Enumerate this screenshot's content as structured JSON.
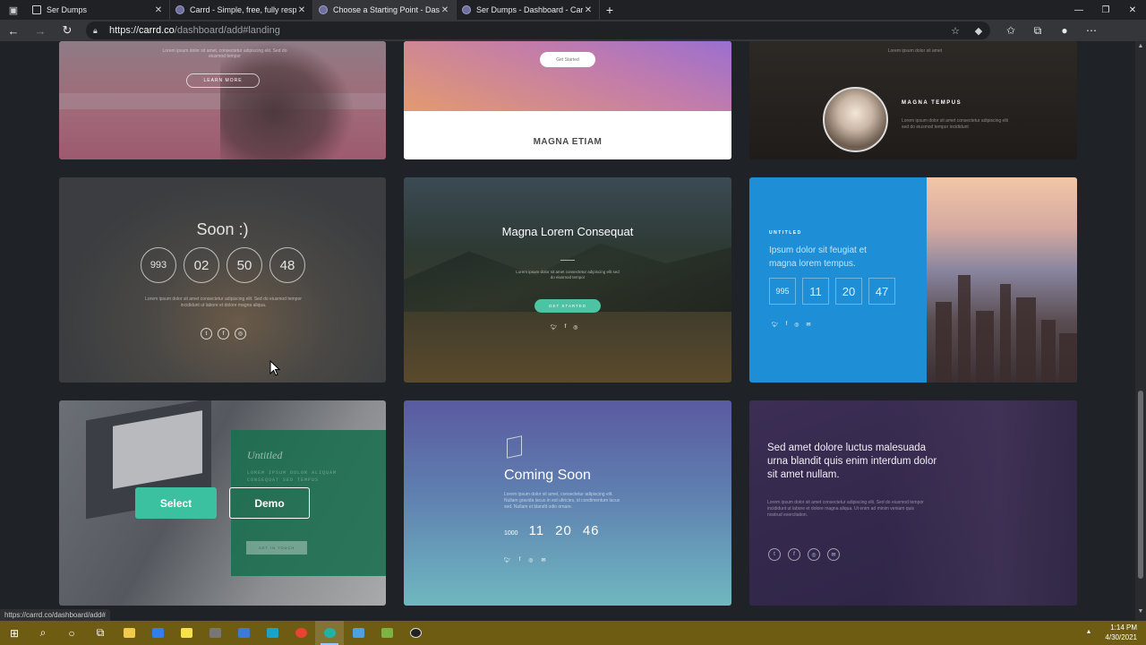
{
  "tabs": [
    {
      "label": "Ser Dumps",
      "favicon": "document-icon",
      "active": false
    },
    {
      "label": "Carrd - Simple, free, fully respon",
      "favicon": "carrd-icon",
      "active": false
    },
    {
      "label": "Choose a Starting Point - Dashb",
      "favicon": "carrd-icon",
      "active": true
    },
    {
      "label": "Ser Dumps - Dashboard - Carrd",
      "favicon": "carrd-icon",
      "active": false
    }
  ],
  "address": {
    "scheme": "https://",
    "host": "carrd.co",
    "path": "/dashboard/add#landing"
  },
  "cards": {
    "c1": {
      "button": "LEARN MORE",
      "text": "Lorem ipsum dolor sit amet, consectetur adipiscing elit. Sed do eiusmod tempor"
    },
    "c2": {
      "button": "Get Started",
      "title": "MAGNA ETIAM"
    },
    "c3": {
      "title": "MAGNA TEMPUS",
      "text": "Lorem ipsum dolor sit amet consectetur adipiscing elit sed do eiusmod tempor incididunt",
      "toptext": "Lorem ipsum dolor sit amet"
    },
    "c4": {
      "title": "Soon :)",
      "counts": [
        "993",
        "02",
        "50",
        "48"
      ],
      "text": "Lorem ipsum dolor sit amet consectetur adipiscing elit. Sed do eiusmod tempor incididunt ut labore et dolore magna aliqua."
    },
    "c5": {
      "title": "Magna Lorem Consequat",
      "text": "Lorem ipsum dolor sit amet consectetur adipiscing elit sed do eiusmod tempor",
      "button": "GET STARTED"
    },
    "c6": {
      "label": "UNTITLED",
      "headline": "Ipsum dolor sit feugiat et magna lorem tempus.",
      "counts": [
        "995",
        "11",
        "20",
        "47"
      ]
    },
    "c7": {
      "title": "Untitled",
      "text": "LOREM IPSUM DOLOR ALIQUAM CONSEQUAT SED TEMPUS",
      "button": "GET IN TOUCH",
      "select": "Select",
      "demo": "Demo"
    },
    "c8": {
      "title": "Coming Soon",
      "text": "Lorem ipsum dolor sit amet, consectetur adipiscing elit. Nullam gravida lacus in est ultricies, id condimentum lacus sed. Nullam et blandit odio ornare.",
      "counts": [
        "1000",
        "11",
        "20",
        "46"
      ]
    },
    "c9": {
      "headline": "Sed amet dolore luctus malesuada urna blandit quis enim interdum dolor sit amet nullam.",
      "text": "Lorem ipsum dolor sit amet consectetur adipiscing elit. Sed do eiusmod tempor incididunt ut labore et dolore magna aliqua. Ut enim ad minim veniam quis nostrud exercitation."
    }
  },
  "status_url": "https://carrd.co/dashboard/add#",
  "clock": {
    "time": "1:14 PM",
    "date": "4/30/2021"
  },
  "colors": {
    "accent": "#3cc1a0",
    "taskbar": "#6e5c12",
    "page_bg": "#1f2226"
  }
}
